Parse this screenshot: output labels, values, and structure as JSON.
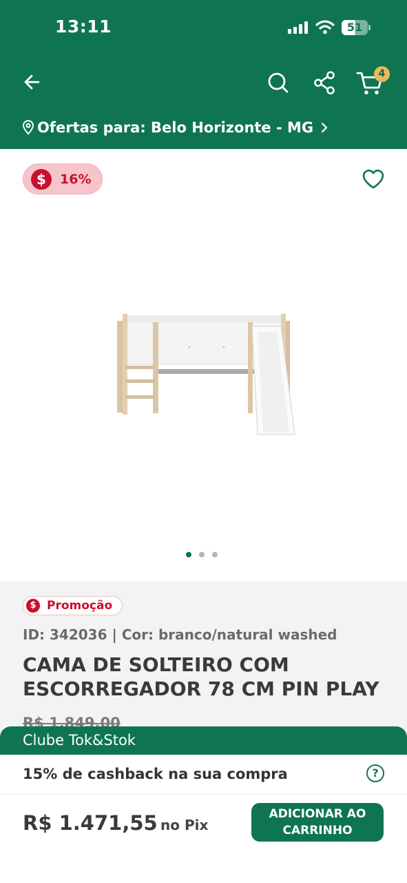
{
  "status_bar": {
    "time": "13:11",
    "battery": "51"
  },
  "header": {
    "cart_count": "4",
    "location_label": "Ofertas para: Belo Horizonte - MG"
  },
  "icons": {
    "back": "arrow-left-icon",
    "search": "search-icon",
    "share": "share-icon",
    "cart": "cart-icon",
    "location": "location-pin-icon",
    "favorite": "heart-icon",
    "help": "help-icon"
  },
  "gallery": {
    "discount": "16%",
    "currency_symbol": "$",
    "image_count": 3,
    "active_index": 0
  },
  "product": {
    "promo_badge": "Promoção",
    "meta": "ID: 342036 | Cor: branco/natural washed",
    "title": "CAMA DE SOLTEIRO COM ESCORREGADOR 78 CM PIN PLAY",
    "old_price": "R$ 1.849,00"
  },
  "club": {
    "label": "Clube Tok&Stok",
    "cashback": "15% de cashback na sua compra",
    "help_glyph": "?"
  },
  "purchase": {
    "price": "R$ 1.471,55",
    "price_suffix": "no Pix",
    "add_button": "ADICIONAR AO CARRINHO"
  },
  "colors": {
    "brand_green": "#0f7550",
    "promo_red": "#c8102e",
    "discount_pink": "#f6c5cb",
    "cart_badge": "#e8b85c"
  }
}
